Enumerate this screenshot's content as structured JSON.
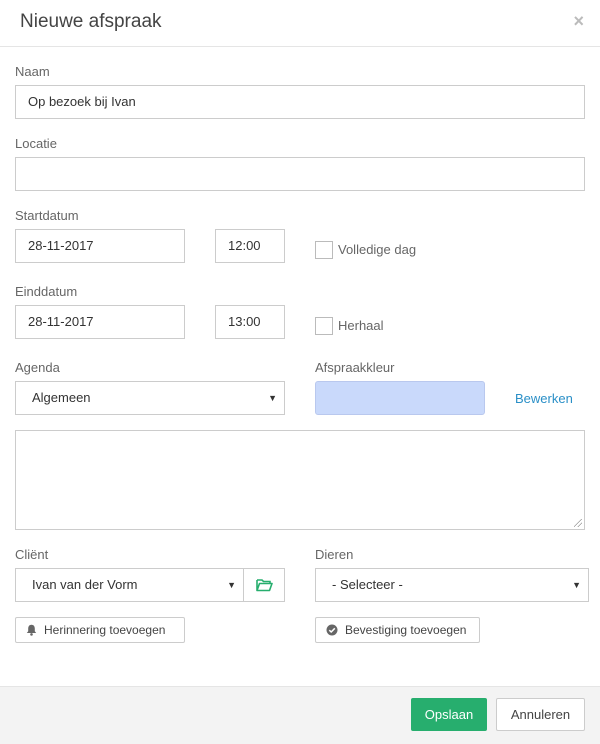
{
  "dialog": {
    "title": "Nieuwe afspraak",
    "close_symbol": "×"
  },
  "form": {
    "name": {
      "label": "Naam",
      "value": "Op bezoek bij Ivan"
    },
    "location": {
      "label": "Locatie",
      "value": ""
    },
    "start": {
      "label": "Startdatum",
      "date": "28-11-2017",
      "time": "12:00",
      "allday_label": "Volledige dag",
      "allday_checked": false
    },
    "end": {
      "label": "Einddatum",
      "date": "28-11-2017",
      "time": "13:00",
      "repeat_label": "Herhaal",
      "repeat_checked": false
    },
    "agenda": {
      "label": "Agenda",
      "selected": "Algemeen"
    },
    "color": {
      "label": "Afspraakkleur",
      "value": "#c9d9fb",
      "edit_link": "Bewerken"
    },
    "notes": {
      "value": ""
    },
    "client": {
      "label": "Cliënt",
      "selected": "Ivan van der Vorm"
    },
    "animals": {
      "label": "Dieren",
      "selected": "- Selecteer -"
    },
    "reminder_button": "Herinnering toevoegen",
    "confirmation_button": "Bevestiging toevoegen"
  },
  "footer": {
    "save": "Opslaan",
    "cancel": "Annuleren"
  },
  "colors": {
    "primary": "#27ae6e",
    "link": "#2a8fc7",
    "swatch": "#c9d9fb"
  },
  "icons": {
    "folder": "folder-open-icon",
    "bell": "bell-icon",
    "check": "check-circle-icon",
    "caret": "caret-down-icon"
  }
}
